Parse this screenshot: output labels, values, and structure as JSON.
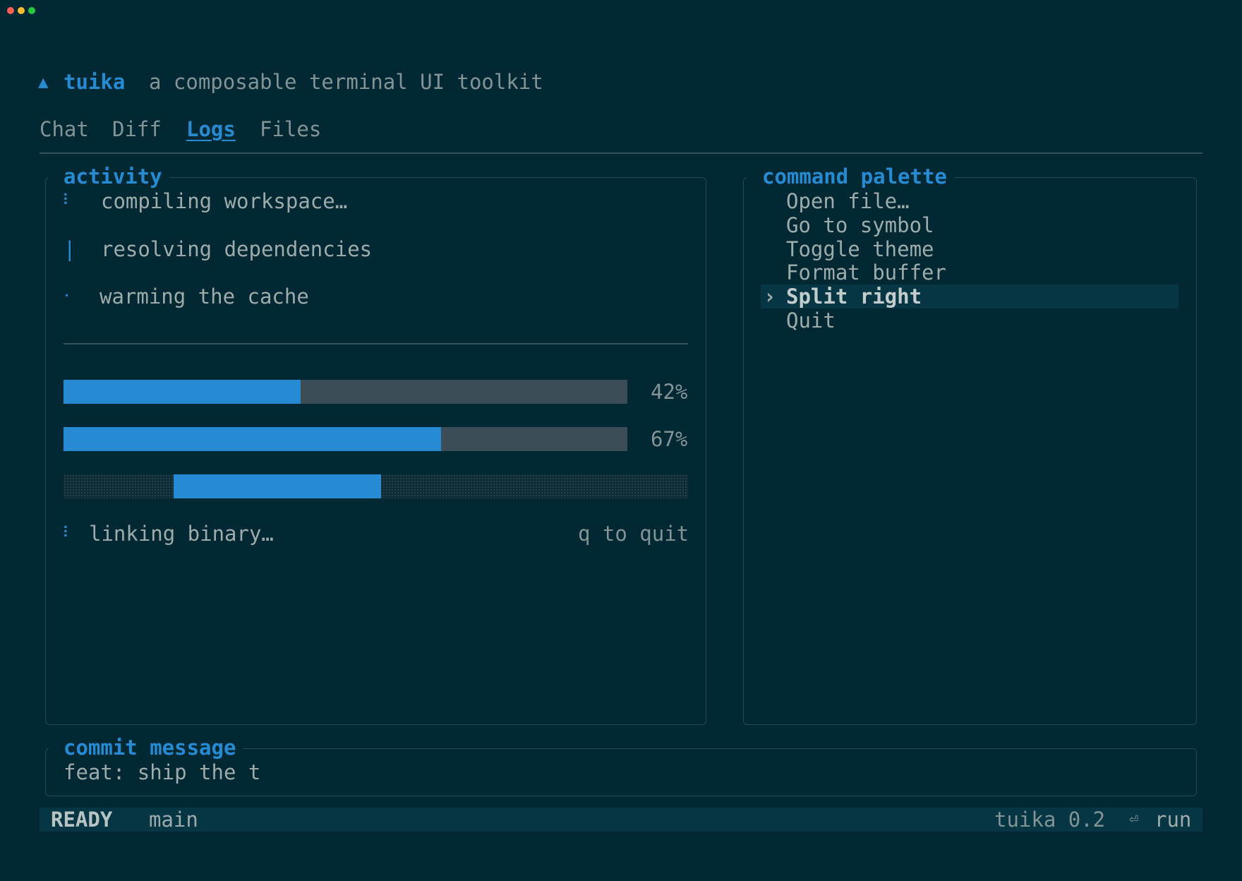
{
  "window": {
    "controls": [
      {
        "name": "close",
        "color": "#ff5f57"
      },
      {
        "name": "minimize",
        "color": "#febc2e"
      },
      {
        "name": "zoom",
        "color": "#28c840"
      }
    ]
  },
  "header": {
    "logo_glyph": "▲",
    "app_name": "tuika",
    "tagline": "a composable terminal UI toolkit"
  },
  "tabs": [
    {
      "label": "Chat",
      "active": false
    },
    {
      "label": "Diff",
      "active": false
    },
    {
      "label": "Logs",
      "active": true
    },
    {
      "label": "Files",
      "active": false
    }
  ],
  "activity": {
    "title": "activity",
    "tasks": [
      {
        "spinner": "⠇",
        "label": "compiling workspace…"
      },
      {
        "spinner": "|",
        "label": "resolving dependencies"
      },
      {
        "spinner": "·",
        "label": "warming the cache"
      }
    ],
    "progress": [
      {
        "percent": 42,
        "label": "42%"
      },
      {
        "percent": 67,
        "label": "67%"
      }
    ],
    "indeterminate": {
      "start_fraction": 0.176,
      "width_fraction": 0.333
    },
    "footer": {
      "spinner": "⠇",
      "status": "linking binary…",
      "hint": "q to quit"
    }
  },
  "palette": {
    "title": "command palette",
    "selected_marker": "›",
    "items": [
      {
        "label": "Open file…",
        "selected": false
      },
      {
        "label": "Go to symbol",
        "selected": false
      },
      {
        "label": "Toggle theme",
        "selected": false
      },
      {
        "label": "Format buffer",
        "selected": false
      },
      {
        "label": "Split right",
        "selected": true
      },
      {
        "label": "Quit",
        "selected": false
      }
    ]
  },
  "commit": {
    "title": "commit message",
    "value": "feat: ship the t"
  },
  "statusbar": {
    "mode": "READY",
    "branch": "main",
    "version": "tuika 0.2",
    "enter_glyph": "⏎",
    "action": "run"
  },
  "colors": {
    "background": "#012833",
    "accent": "#268bd2",
    "track": "#3b4e57",
    "selection": "#063643"
  }
}
